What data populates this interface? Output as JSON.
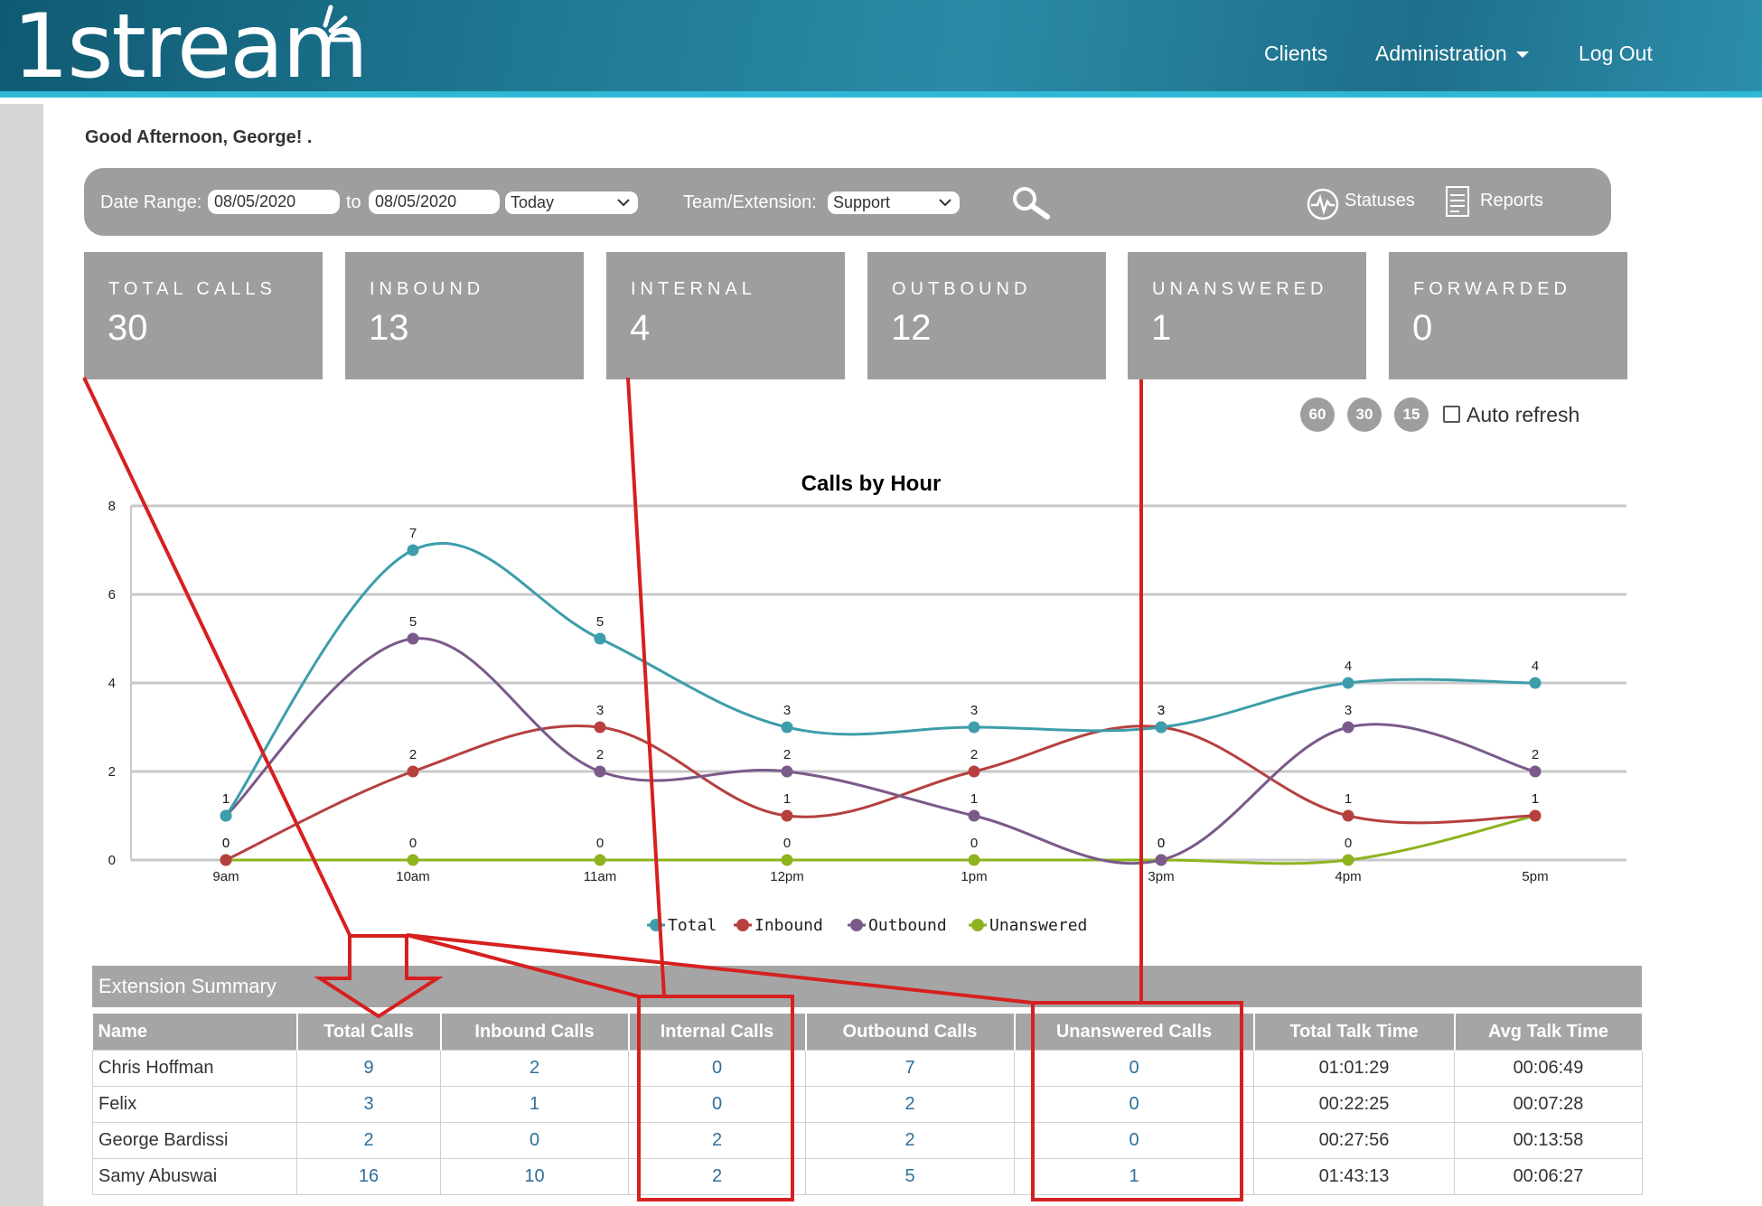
{
  "header": {
    "logo_text": "1stream",
    "nav": {
      "clients": "Clients",
      "administration": "Administration",
      "logout": "Log Out"
    }
  },
  "greeting": "Good Afternoon, George!  .",
  "filter": {
    "date_range_label": "Date Range:",
    "date_from": "08/05/2020",
    "to_label": "to",
    "date_to": "08/05/2020",
    "range_select": "Today",
    "team_label": "Team/Extension:",
    "team_select": "Support",
    "statuses_label": "Statuses",
    "reports_label": "Reports"
  },
  "tiles": [
    {
      "label": "TOTAL CALLS",
      "value": "30"
    },
    {
      "label": "INBOUND",
      "value": "13"
    },
    {
      "label": "INTERNAL",
      "value": "4"
    },
    {
      "label": "OUTBOUND",
      "value": "12"
    },
    {
      "label": "UNANSWERED",
      "value": "1"
    },
    {
      "label": "FORWARDED",
      "value": "0"
    }
  ],
  "refresh": {
    "buttons": [
      "60",
      "30",
      "15"
    ],
    "auto_label": "Auto refresh"
  },
  "colors": {
    "total": "#3d9dab",
    "inbound": "#b5403e",
    "outbound": "#7a5a8a",
    "unanswered": "#8db41f",
    "annotation": "#d62020"
  },
  "chart_data": {
    "type": "line",
    "title": "Calls by Hour",
    "categories": [
      "9am",
      "10am",
      "11am",
      "12pm",
      "1pm",
      "3pm",
      "4pm",
      "5pm"
    ],
    "ylim": [
      0,
      8
    ],
    "yticks": [
      0,
      2,
      4,
      6,
      8
    ],
    "grid": true,
    "legend": "bottom",
    "series": [
      {
        "name": "Total",
        "color": "#3d9dab",
        "values": [
          1,
          7,
          5,
          3,
          3,
          3,
          4,
          4
        ]
      },
      {
        "name": "Inbound",
        "color": "#b5403e",
        "values": [
          0,
          2,
          3,
          1,
          2,
          3,
          1,
          1
        ]
      },
      {
        "name": "Outbound",
        "color": "#7a5a8a",
        "values": [
          1,
          5,
          2,
          2,
          1,
          0,
          3,
          2
        ]
      },
      {
        "name": "Unanswered",
        "color": "#8db41f",
        "values": [
          0,
          0,
          0,
          0,
          0,
          0,
          0,
          1
        ]
      }
    ],
    "labels": [
      [
        1,
        7,
        5,
        3,
        3,
        3,
        4,
        4
      ],
      [
        0,
        2,
        3,
        1,
        2,
        3,
        1,
        1
      ],
      [
        1,
        5,
        2,
        2,
        1,
        0,
        3,
        2
      ],
      [
        0,
        0,
        0,
        0,
        0,
        0,
        0,
        1
      ]
    ]
  },
  "summary": {
    "title": "Extension Summary",
    "columns": [
      "Name",
      "Total Calls",
      "Inbound Calls",
      "Internal Calls",
      "Outbound Calls",
      "Unanswered Calls",
      "Total Talk Time",
      "Avg Talk Time"
    ],
    "rows": [
      [
        "Chris Hoffman",
        "9",
        "2",
        "0",
        "7",
        "0",
        "01:01:29",
        "00:06:49"
      ],
      [
        "Felix",
        "3",
        "1",
        "0",
        "2",
        "0",
        "00:22:25",
        "00:07:28"
      ],
      [
        "George Bardissi",
        "2",
        "0",
        "2",
        "2",
        "0",
        "00:27:56",
        "00:13:58"
      ],
      [
        "Samy Abuswai",
        "16",
        "10",
        "2",
        "5",
        "1",
        "01:43:13",
        "00:06:27"
      ]
    ]
  }
}
